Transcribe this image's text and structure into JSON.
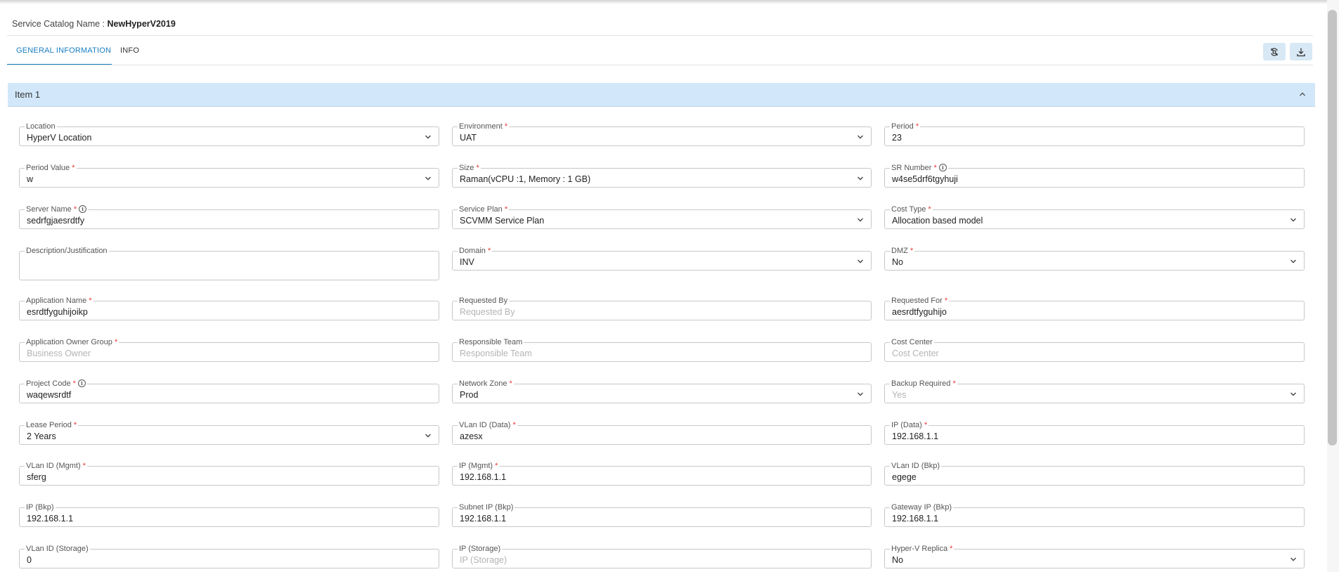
{
  "header": {
    "label": "Service Catalog Name :",
    "value": "NewHyperV2019"
  },
  "tabs": [
    {
      "label": "GENERAL INFORMATION"
    },
    {
      "label": "INFO"
    }
  ],
  "toolbar": {
    "refresh_icon": "refresh-icon",
    "download_icon": "download-icon"
  },
  "panel": {
    "title": "Item 1"
  },
  "fields": {
    "location": {
      "label": "Location",
      "value": "HyperV Location"
    },
    "environment": {
      "label": "Environment",
      "value": "UAT"
    },
    "period": {
      "label": "Period",
      "value": "23"
    },
    "period_value": {
      "label": "Period Value",
      "value": "w"
    },
    "size": {
      "label": "Size",
      "value": "Raman(vCPU :1, Memory : 1 GB)"
    },
    "sr_number": {
      "label": "SR Number",
      "value": "w4se5drf6tgyhuji"
    },
    "server_name": {
      "label": "Server Name",
      "value": "sedrfgjaesrdtfy"
    },
    "service_plan": {
      "label": "Service Plan",
      "value": "SCVMM Service Plan"
    },
    "cost_type": {
      "label": "Cost Type",
      "value": "Allocation based model"
    },
    "description": {
      "label": "Description/Justification",
      "value": ""
    },
    "domain": {
      "label": "Domain",
      "value": "INV"
    },
    "dmz": {
      "label": "DMZ",
      "value": "No"
    },
    "application_name": {
      "label": "Application Name",
      "value": "esrdtfyguhijoikp"
    },
    "requested_by": {
      "label": "Requested By",
      "placeholder": "Requested By"
    },
    "requested_for": {
      "label": "Requested For",
      "value": "aesrdtfyguhijo"
    },
    "app_owner_group": {
      "label": "Application Owner Group",
      "placeholder": "Business Owner"
    },
    "responsible_team": {
      "label": "Responsible Team",
      "placeholder": "Responsible Team"
    },
    "cost_center": {
      "label": "Cost Center",
      "placeholder": "Cost Center"
    },
    "project_code": {
      "label": "Project Code",
      "value": "waqewsrdtf"
    },
    "network_zone": {
      "label": "Network Zone",
      "value": "Prod"
    },
    "backup_required": {
      "label": "Backup Required",
      "placeholder": "Yes"
    },
    "lease_period": {
      "label": "Lease Period",
      "value": "2 Years"
    },
    "vlan_data": {
      "label": "VLan ID (Data)",
      "value": "azesx"
    },
    "ip_data": {
      "label": "IP (Data)",
      "value": "192.168.1.1"
    },
    "vlan_mgmt": {
      "label": "VLan ID (Mgmt)",
      "value": "sferg"
    },
    "ip_mgmt": {
      "label": "IP (Mgmt)",
      "value": "192.168.1.1"
    },
    "vlan_bkp": {
      "label": "VLan ID (Bkp)",
      "value": "egege"
    },
    "ip_bkp": {
      "label": "IP (Bkp)",
      "value": "192.168.1.1"
    },
    "subnet_bkp": {
      "label": "Subnet IP (Bkp)",
      "value": "192.168.1.1"
    },
    "gateway_bkp": {
      "label": "Gateway IP (Bkp)",
      "value": "192.168.1.1"
    },
    "vlan_storage": {
      "label": "VLan ID (Storage)",
      "value": "0"
    },
    "ip_storage": {
      "label": "IP (Storage)",
      "placeholder": "IP (Storage)"
    },
    "hyperv_replica": {
      "label": "Hyper-V Replica",
      "value": "No"
    }
  },
  "colors": {
    "accent": "#1a7fc1",
    "panel_header": "#d2e8fa",
    "required": "#e53935"
  }
}
